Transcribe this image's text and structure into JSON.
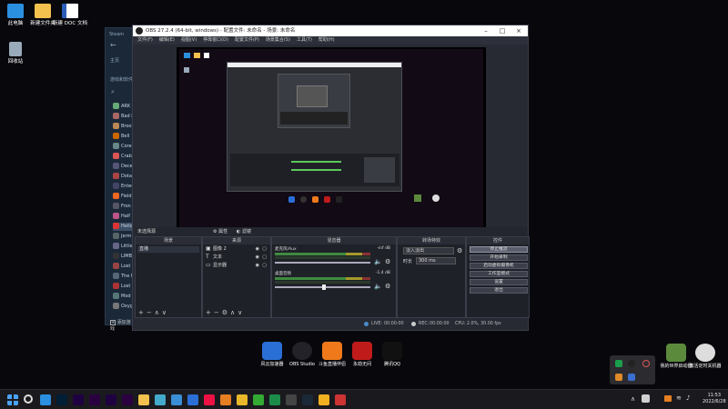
{
  "desktop": {
    "icons": [
      {
        "label": "此电脑",
        "icon": "computer-icon"
      },
      {
        "label": "新建文件夹",
        "icon": "folder-icon"
      },
      {
        "label": "新建 DOC 文档",
        "icon": "word-doc-icon"
      },
      {
        "label": "回收站",
        "icon": "recycle-bin-icon"
      }
    ],
    "shortcuts": [
      {
        "label": "风云加速器",
        "icon": "rocket-icon",
        "color": "#2a6fd6"
      },
      {
        "label": "OBS Studio",
        "icon": "obs-icon",
        "color": "#222228"
      },
      {
        "label": "斗鱼直播伴侣",
        "icon": "douyu-icon",
        "color": "#f07a1b"
      },
      {
        "label": "永劫无间",
        "icon": "naraka-icon",
        "color": "#c01b1b"
      },
      {
        "label": "腾讯QQ",
        "icon": "qq-icon",
        "color": "#111111"
      }
    ],
    "right_shortcuts": [
      {
        "label": "我的世界启动器",
        "icon": "minecraft-icon",
        "color": "#5b8a3c"
      },
      {
        "label": "激活定时关机器",
        "icon": "power-icon",
        "color": "#dddddd"
      }
    ]
  },
  "steam": {
    "title": "Steam",
    "nav": "主页",
    "section": "游戏和软件",
    "games": [
      "ARK",
      "Bad N",
      "Brool",
      "Bell",
      "Core",
      "Crab",
      "Dece",
      "Dota",
      "Enter",
      "Field",
      "Fron",
      "Half",
      "Hello",
      "Jerm",
      "Little",
      "LIMB",
      "Lost",
      "The M",
      "Lost",
      "Mod",
      "Oxyg"
    ],
    "add_game": "添加游戏"
  },
  "obs": {
    "title": "OBS 27.2.4 (64-bit, windows) - 配置文件: 未命名 - 场景: 未命名",
    "menu": [
      "文件(F)",
      "编辑(E)",
      "视图(V)",
      "停靠窗口(D)",
      "配置文件(P)",
      "场景集合(S)",
      "工具(T)",
      "帮助(H)"
    ],
    "source_bar": {
      "label": "未选择源",
      "props": "属性",
      "filters": "滤镜"
    },
    "scenes": {
      "title": "场景",
      "items": [
        "直播"
      ]
    },
    "sources": {
      "title": "来源",
      "items": [
        {
          "name": "图像 2",
          "icon": "image-icon"
        },
        {
          "name": "文本",
          "icon": "text-icon"
        },
        {
          "name": "显示器",
          "icon": "monitor-icon"
        }
      ]
    },
    "mixer": {
      "title": "混音器",
      "channels": [
        {
          "name": "麦克风/Aux",
          "db": "-inf dB"
        },
        {
          "name": "桌面音频",
          "db": "-1.4 dB"
        }
      ]
    },
    "transitions": {
      "title": "转场特效",
      "type": "淡入淡出",
      "duration_label": "时长",
      "duration": "300 ms"
    },
    "controls": {
      "title": "控件",
      "buttons": [
        "停止推流",
        "开始录制",
        "启动虚拟摄像机",
        "工作室模式",
        "设置",
        "退出"
      ]
    },
    "status": {
      "live_label": "LIVE:",
      "live_time": "00:00:00",
      "rec_label": "REC:",
      "rec_time": "00:00:00",
      "cpu": "CPU: 2.0%, 30.00 fps"
    }
  },
  "taskbar": {
    "apps": [
      "windows-start-icon",
      "search-icon",
      "files-icon",
      "photoshop-icon",
      "after-effects-icon",
      "media-encoder-icon",
      "ae-icon",
      "premiere-icon",
      "folder-icon",
      "arrow-app-icon",
      "edge-icon",
      "mail-icon",
      "snip-icon",
      "browser-icon",
      "chrome-icon",
      "app-icon",
      "pycharm-icon",
      "browser2-icon",
      "steam-icon",
      "coin-icon",
      "obs-task-icon"
    ],
    "time": "11:53",
    "date": "2022/6/28"
  }
}
